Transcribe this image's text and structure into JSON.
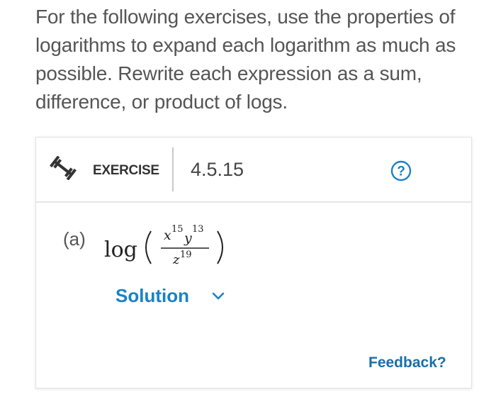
{
  "intro": {
    "text": "For the following exercises, use the properties of logarithms to expand each logarithm as much as possible. Rewrite each expression as a sum, difference, or product of logs."
  },
  "exercise": {
    "label": "EXERCISE",
    "number": "4.5.15",
    "help_icon": "question-circle-icon",
    "type_icon": "dumbbell-icon"
  },
  "part_a": {
    "label": "(a)",
    "math": {
      "func": "log",
      "num_x": "x",
      "num_x_exp": "15",
      "num_y": "y",
      "num_y_exp": "13",
      "den_z": "z",
      "den_z_exp": "19"
    },
    "solution_label": "Solution"
  },
  "feedback_label": "Feedback?",
  "colors": {
    "accent": "#1a82c6",
    "feedback": "#1a6fa8",
    "text": "#555555"
  }
}
